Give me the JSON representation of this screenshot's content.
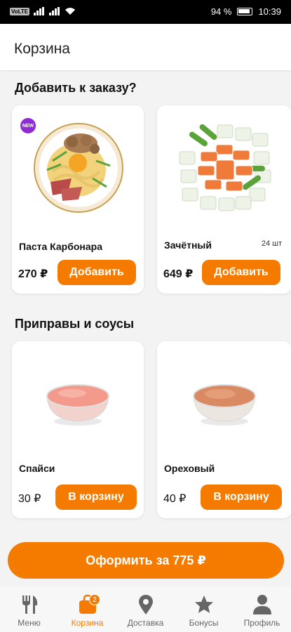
{
  "status_bar": {
    "left_chip": "VoLTE",
    "battery": "94 %",
    "time": "10:39"
  },
  "header": {
    "title": "Корзина"
  },
  "sections": [
    {
      "title": "Добавить к заказу?"
    },
    {
      "title": "Приправы и соусы"
    }
  ],
  "add_items": [
    {
      "name": "Паста Карбонара",
      "price": "270 ₽",
      "button": "Добавить",
      "badge": "NEW",
      "count": ""
    },
    {
      "name": "Зачётный",
      "price": "649 ₽",
      "button": "Добавить",
      "badge": "",
      "count": "24 шт"
    }
  ],
  "sauces": [
    {
      "name": "Спайси",
      "price": "30 ₽",
      "button": "В корзину",
      "sauce_color": "#f49a8c"
    },
    {
      "name": "Ореховый",
      "price": "40 ₽",
      "button": "В корзину",
      "sauce_color": "#d98a63"
    }
  ],
  "checkout": {
    "label": "Оформить за 775 ₽"
  },
  "tabs": [
    {
      "label": "Меню",
      "icon": "fork-knife-icon",
      "active": false
    },
    {
      "label": "Корзина",
      "icon": "shopping-bag-icon",
      "active": true,
      "badge": "2"
    },
    {
      "label": "Доставка",
      "icon": "location-pin-icon",
      "active": false
    },
    {
      "label": "Бонусы",
      "icon": "star-icon",
      "active": false
    },
    {
      "label": "Профиль",
      "icon": "person-icon",
      "active": false
    }
  ],
  "colors": {
    "accent": "#f57b00",
    "new_badge": "#8e2bd4",
    "background": "#f3f3f3"
  }
}
